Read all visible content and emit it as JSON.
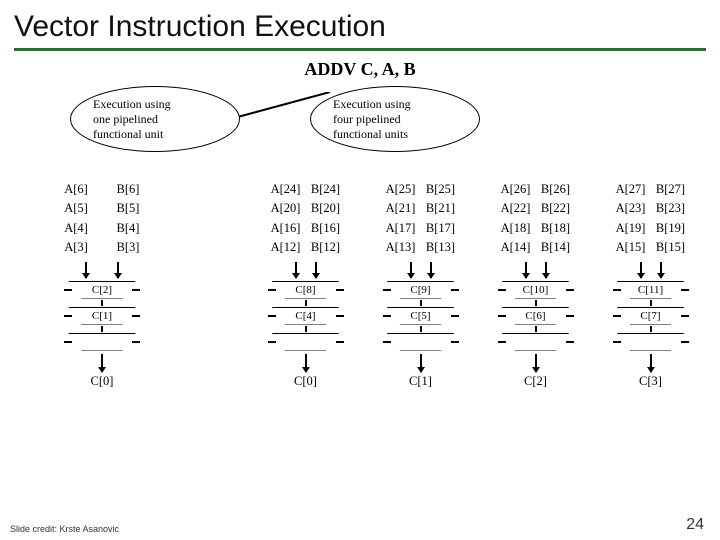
{
  "title": "Vector Instruction Execution",
  "instruction": "ADDV C, A, B",
  "bubble_left": "Execution using\none pipelined\nfunctional unit",
  "bubble_right": "Execution using\nfour pipelined\nfunctional units",
  "single": {
    "rows": [
      {
        "a": "A[6]",
        "b": "B[6]"
      },
      {
        "a": "A[5]",
        "b": "B[5]"
      },
      {
        "a": "A[4]",
        "b": "B[4]"
      },
      {
        "a": "A[3]",
        "b": "B[3]"
      }
    ],
    "stages": [
      "C[2]",
      "C[1]"
    ],
    "out": "C[0]"
  },
  "quad": [
    {
      "rows": [
        {
          "a": "A[24]",
          "b": "B[24]"
        },
        {
          "a": "A[20]",
          "b": "B[20]"
        },
        {
          "a": "A[16]",
          "b": "B[16]"
        },
        {
          "a": "A[12]",
          "b": "B[12]"
        }
      ],
      "stages": [
        "C[8]",
        "C[4]"
      ],
      "out": "C[0]"
    },
    {
      "rows": [
        {
          "a": "A[25]",
          "b": "B[25]"
        },
        {
          "a": "A[21]",
          "b": "B[21]"
        },
        {
          "a": "A[17]",
          "b": "B[17]"
        },
        {
          "a": "A[13]",
          "b": "B[13]"
        }
      ],
      "stages": [
        "C[9]",
        "C[5]"
      ],
      "out": "C[1]"
    },
    {
      "rows": [
        {
          "a": "A[26]",
          "b": "B[26]"
        },
        {
          "a": "A[22]",
          "b": "B[22]"
        },
        {
          "a": "A[18]",
          "b": "B[18]"
        },
        {
          "a": "A[14]",
          "b": "B[14]"
        }
      ],
      "stages": [
        "C[10]",
        "C[6]"
      ],
      "out": "C[2]"
    },
    {
      "rows": [
        {
          "a": "A[27]",
          "b": "B[27]"
        },
        {
          "a": "A[23]",
          "b": "B[23]"
        },
        {
          "a": "A[19]",
          "b": "B[19]"
        },
        {
          "a": "A[15]",
          "b": "B[15]"
        }
      ],
      "stages": [
        "C[11]",
        "C[7]"
      ],
      "out": "C[3]"
    }
  ],
  "credit": "Slide credit: Krste Asanovic",
  "page": "24"
}
